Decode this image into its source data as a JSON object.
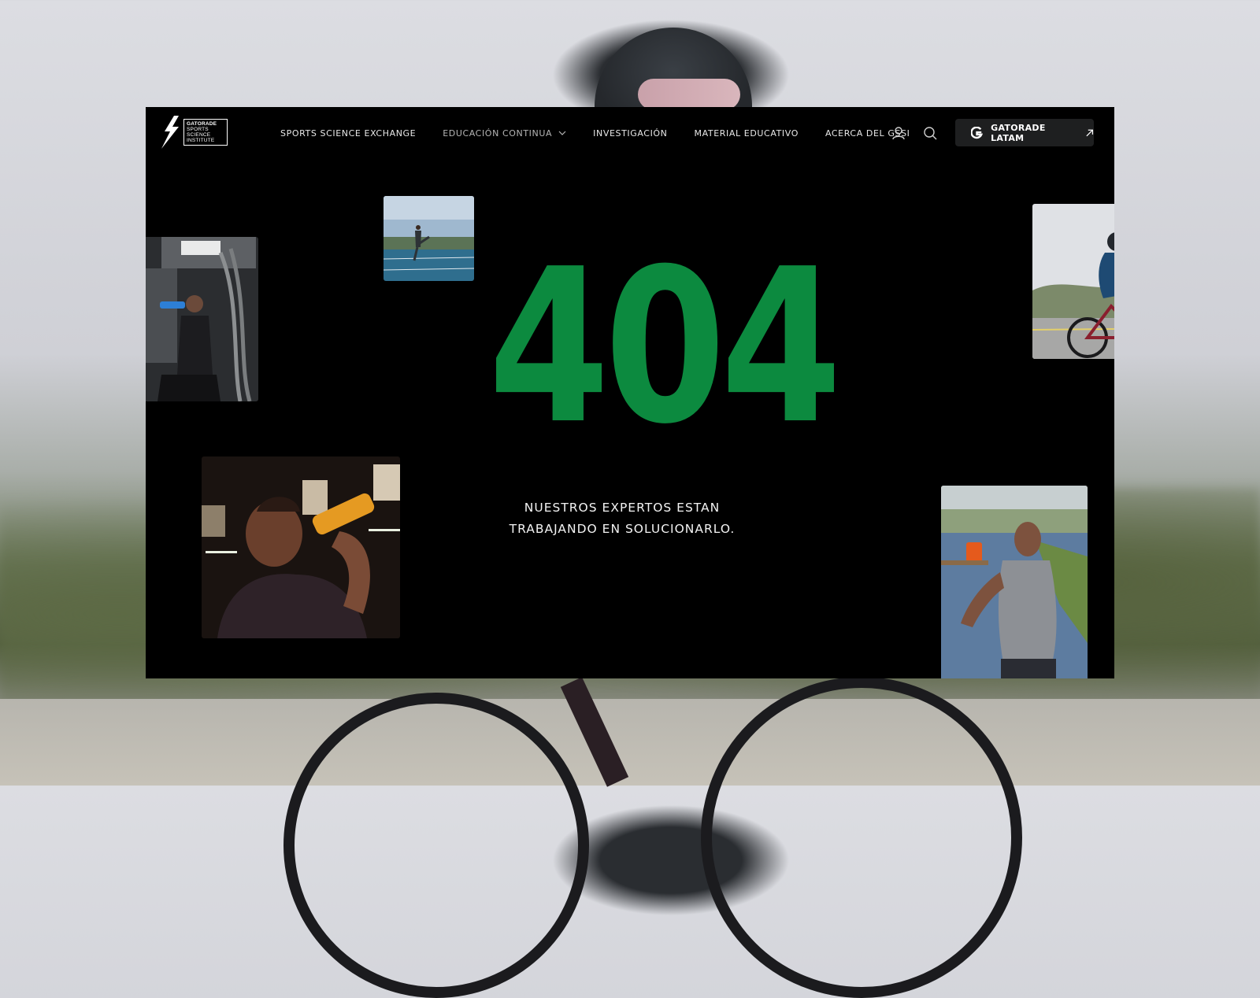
{
  "nav": {
    "items": [
      {
        "label": "SPORTS SCIENCE EXCHANGE"
      },
      {
        "label": "EDUCACIÓN CONTINUA"
      },
      {
        "label": "INVESTIGACIÓN"
      },
      {
        "label": "MATERIAL EDUCATIVO"
      },
      {
        "label": "ACERCA DEL GSSI"
      }
    ],
    "cta_label": "GATORADE LATAM"
  },
  "logo": {
    "line1": "GATORADE",
    "line2": "SPORTS",
    "line3": "SCIENCE",
    "line4": "INSTITUTE"
  },
  "error": {
    "code": "404",
    "message_line1": "NUESTROS EXPERTOS ESTAN",
    "message_line2": "TRABAJANDO EN SOLUCIONARLO."
  },
  "colors": {
    "accent": "#0c8a3f",
    "page_bg": "#000000",
    "cta_bg": "#1e1f20"
  },
  "icons": [
    "user-icon",
    "search-icon",
    "gatorade-g-icon",
    "external-arrow-icon",
    "chevron-down-icon"
  ]
}
